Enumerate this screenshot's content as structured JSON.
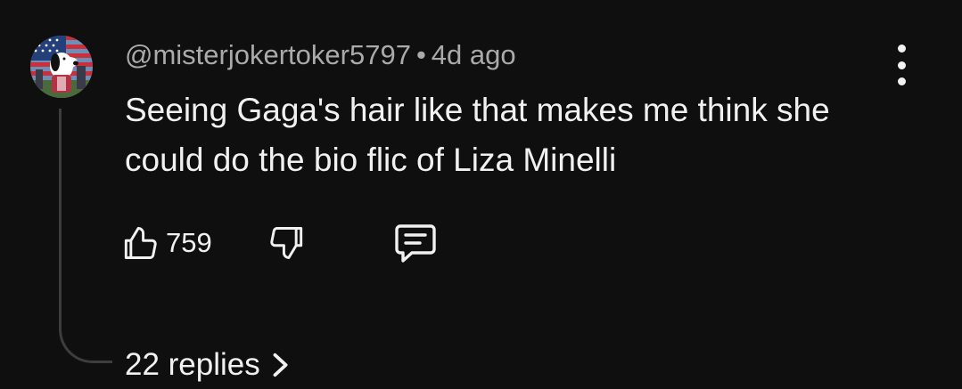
{
  "comment": {
    "author": "@misterjokertoker5797",
    "separator": "•",
    "timestamp": "4d ago",
    "text": "Seeing Gaga's hair like that makes me think she could do the bio flic of Liza Minelli",
    "like_count": "759",
    "replies_label": "22 replies"
  },
  "icons": {
    "avatar": "snoopy-flag-avatar",
    "more": "vertical-dots-icon",
    "like": "thumbs-up-icon",
    "dislike": "thumbs-down-icon",
    "reply": "comment-bubble-icon",
    "chevron": "chevron-right-icon"
  },
  "colors": {
    "background": "#0f0f0f",
    "text_primary": "#f1f1f1",
    "text_secondary": "#aaaaaa",
    "thread_line": "#3d3d3d"
  }
}
